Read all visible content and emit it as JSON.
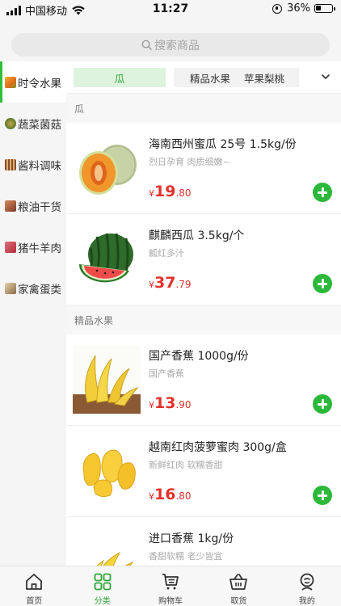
{
  "status_bar": {
    "carrier": "中国移动",
    "time": "11:27",
    "battery": "36%"
  },
  "search": {
    "placeholder": "搜索商品"
  },
  "sidebar": {
    "active_index": 0,
    "items": [
      {
        "label": "时令水果",
        "icon": "fruit-icon",
        "color": "#e08a2a"
      },
      {
        "label": "蔬菜菌菇",
        "icon": "vegetable-icon",
        "color": "#5a7a2a"
      },
      {
        "label": "酱料调味",
        "icon": "sauce-icon",
        "color": "#8a4a2a"
      },
      {
        "label": "粮油干货",
        "icon": "grain-icon",
        "color": "#9a5a3a"
      },
      {
        "label": "猪牛羊肉",
        "icon": "meat-icon",
        "color": "#c8485a"
      },
      {
        "label": "家禽蛋类",
        "icon": "egg-icon",
        "color": "#b08a5a"
      }
    ]
  },
  "tabs": {
    "items": [
      {
        "label": "瓜",
        "active": true
      },
      {
        "label": "精品水果",
        "active": false
      },
      {
        "label": "苹果梨桃",
        "active": false
      }
    ]
  },
  "sections": [
    {
      "title": "瓜",
      "products": [
        {
          "name": "海南西州蜜瓜 25号 1.5kg/份",
          "desc": "烈日孕育 肉质细嫩~",
          "currency": "¥",
          "price_int": "19",
          "price_dec": ".80",
          "image": "melon-image"
        },
        {
          "name": "麒麟西瓜   3.5kg/个",
          "desc": "瓤红多汁",
          "currency": "¥",
          "price_int": "37",
          "price_dec": ".79",
          "image": "watermelon-image"
        }
      ]
    },
    {
      "title": "精品水果",
      "products": [
        {
          "name": "国产香蕉   1000g/份",
          "desc": "国产香蕉",
          "currency": "¥",
          "price_int": "13",
          "price_dec": ".90",
          "image": "banana-image"
        },
        {
          "name": "越南红肉菠萝蜜肉 300g/盒",
          "desc": "新鲜红肉 软糯香甜",
          "currency": "¥",
          "price_int": "16",
          "price_dec": ".80",
          "image": "jackfruit-image"
        },
        {
          "name": "进口香蕉   1kg/份",
          "desc": "香甜软糯 老少皆宜",
          "currency": "¥",
          "price_int": "",
          "price_dec": "",
          "image": "banana-image"
        }
      ]
    }
  ],
  "tabbar": {
    "active_index": 1,
    "items": [
      {
        "label": "首页",
        "icon": "home-icon"
      },
      {
        "label": "分类",
        "icon": "category-icon"
      },
      {
        "label": "购物车",
        "icon": "cart-icon"
      },
      {
        "label": "取货",
        "icon": "basket-icon"
      },
      {
        "label": "我的",
        "icon": "profile-icon"
      }
    ]
  },
  "colors": {
    "accent": "#2fbf3a",
    "price": "#e4312b",
    "add_button": "#2cb83a"
  }
}
